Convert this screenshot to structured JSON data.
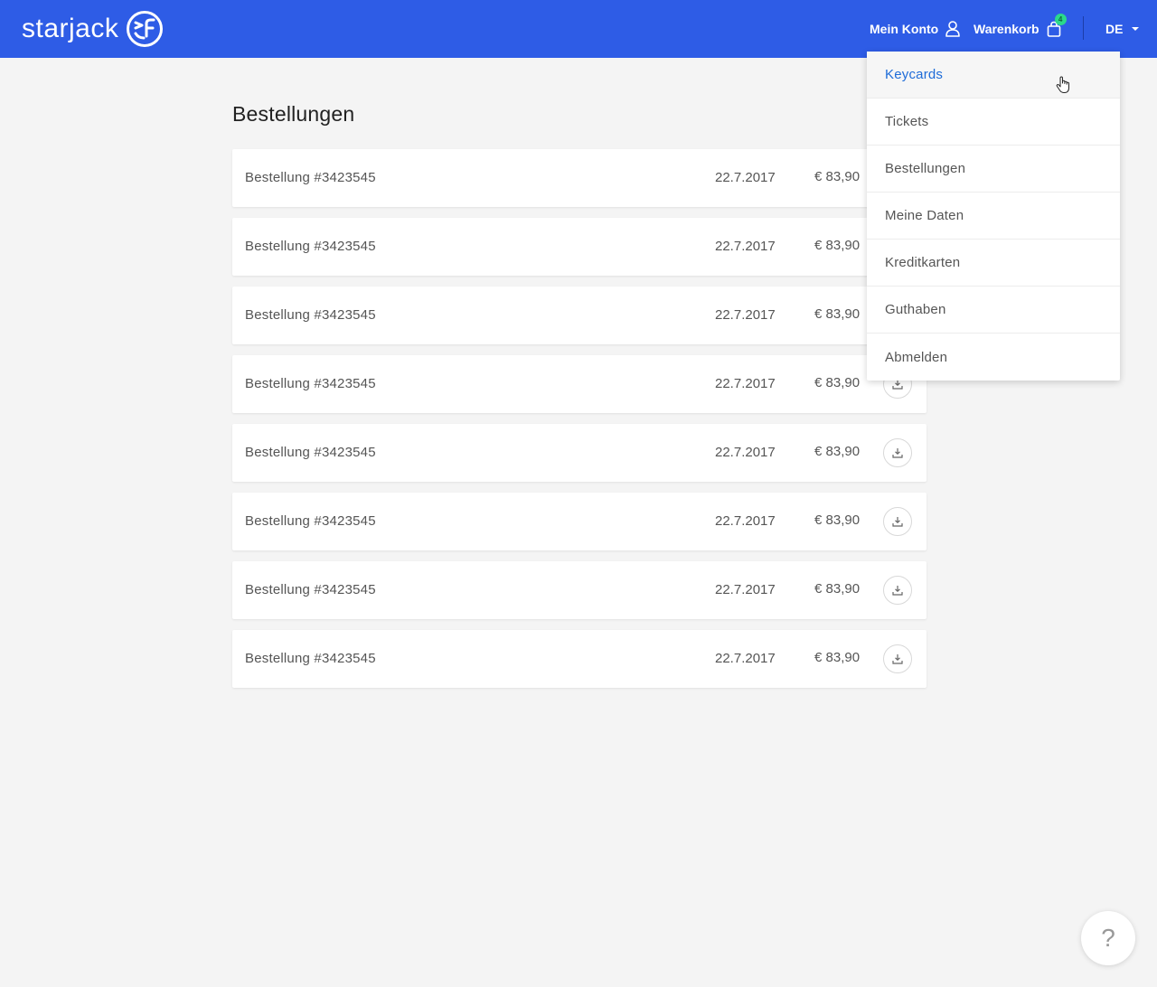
{
  "header": {
    "logo_text": "starjack",
    "account_label": "Mein Konto",
    "cart_label": "Warenkorb",
    "cart_count": "4",
    "language": "DE"
  },
  "main": {
    "title": "Bestellungen",
    "orders": [
      {
        "name": "Bestellung #3423545",
        "date": "22.7.2017",
        "price": "€ 83,90"
      },
      {
        "name": "Bestellung #3423545",
        "date": "22.7.2017",
        "price": "€ 83,90"
      },
      {
        "name": "Bestellung #3423545",
        "date": "22.7.2017",
        "price": "€ 83,90"
      },
      {
        "name": "Bestellung #3423545",
        "date": "22.7.2017",
        "price": "€ 83,90"
      },
      {
        "name": "Bestellung #3423545",
        "date": "22.7.2017",
        "price": "€ 83,90"
      },
      {
        "name": "Bestellung #3423545",
        "date": "22.7.2017",
        "price": "€ 83,90"
      },
      {
        "name": "Bestellung #3423545",
        "date": "22.7.2017",
        "price": "€ 83,90"
      },
      {
        "name": "Bestellung #3423545",
        "date": "22.7.2017",
        "price": "€ 83,90"
      }
    ]
  },
  "account_menu": {
    "items": [
      {
        "label": "Keycards",
        "active": true
      },
      {
        "label": "Tickets"
      },
      {
        "label": "Bestellungen"
      },
      {
        "label": "Meine Daten"
      },
      {
        "label": "Kreditkarten"
      },
      {
        "label": "Guthaben"
      },
      {
        "label": "Abmelden"
      }
    ]
  },
  "help": {
    "label": "?"
  },
  "colors": {
    "header_bg": "#2e5ce6",
    "page_bg": "#f4f4f4",
    "active_link": "#1e6cd8",
    "badge": "#2bd98b"
  },
  "icons": [
    "user-icon",
    "shopping-bag-icon",
    "chevron-down-icon",
    "download-icon",
    "help-icon"
  ]
}
